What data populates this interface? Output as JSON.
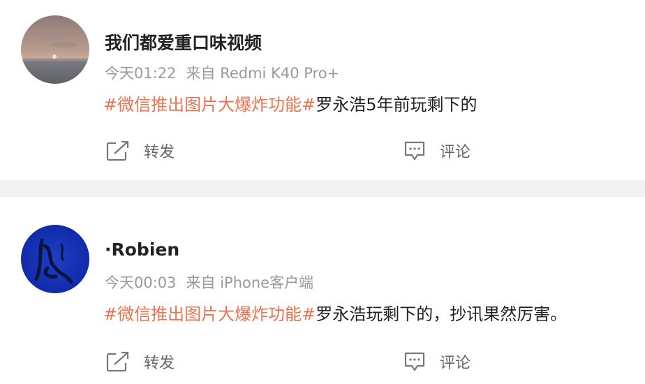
{
  "posts": [
    {
      "username": "我们都爱重口味视频",
      "avatar_icon": "sunset-avatar",
      "time": "今天01:22",
      "source": "来自 Redmi K40 Pro+",
      "topic": "#微信推出图片大爆炸功能#",
      "text": "罗永浩5年前玩剩下的",
      "actions": {
        "repost": "转发",
        "comment": "评论"
      }
    },
    {
      "username": "·Robien",
      "avatar_icon": "blue-ink-avatar",
      "time": "今天00:03",
      "source": "来自 iPhone客户端",
      "topic": "#微信推出图片大爆炸功能#",
      "text": "罗永浩玩剩下的，抄讯果然厉害。",
      "actions": {
        "repost": "转发",
        "comment": "评论"
      }
    }
  ],
  "colors": {
    "topic": "#eb7350",
    "username": "#222222",
    "meta": "#999999",
    "action": "#666666",
    "divider": "#f2f2f2"
  }
}
